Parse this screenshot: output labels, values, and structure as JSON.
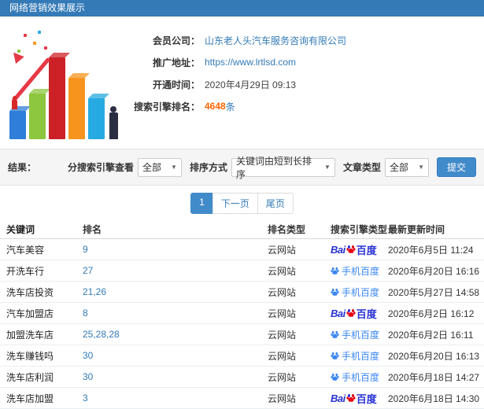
{
  "header": {
    "title": "网络营销效果展示"
  },
  "info": {
    "rows": [
      {
        "label": "会员公司：",
        "value": "山东老人头汽车服务咨询有限公司"
      },
      {
        "label": "推广地址：",
        "value": "https://www.lrtlsd.com"
      },
      {
        "label": "开通时间：",
        "value": "2020年4月29日 09:13"
      },
      {
        "label": "搜索引擎排名：",
        "value": "4648",
        "unit": "条"
      }
    ]
  },
  "filters": {
    "section_label": "结果：",
    "groups": [
      {
        "label": "分搜索引擎查看",
        "value": "全部"
      },
      {
        "label": "排序方式",
        "value": "关键词由短到长排序"
      },
      {
        "label": "文章类型",
        "value": "全部"
      }
    ],
    "submit_label": "提交"
  },
  "pagination": {
    "current": "1",
    "next_label": "下一页",
    "last_label": "尾页"
  },
  "table": {
    "headers": [
      "关键词",
      "排名",
      "排名类型",
      "搜索引擎类型",
      "最新更新时间"
    ],
    "engine": {
      "baidu_bai": "Bai",
      "baidu_text": "百度",
      "mobile_text": "手机百度"
    },
    "rows": [
      {
        "keyword": "汽车美容",
        "rank": "9",
        "rank_type": "云网站",
        "engine": "baidu",
        "time": "2020年6月5日 11:24"
      },
      {
        "keyword": "开洗车行",
        "rank": "27",
        "rank_type": "云网站",
        "engine": "mobile",
        "time": "2020年6月20日 16:16"
      },
      {
        "keyword": "洗车店投资",
        "rank": "21,26",
        "rank_type": "云网站",
        "engine": "mobile",
        "time": "2020年5月27日 14:58"
      },
      {
        "keyword": "汽车加盟店",
        "rank": "8",
        "rank_type": "云网站",
        "engine": "baidu",
        "time": "2020年6月2日 16:12"
      },
      {
        "keyword": "加盟洗车店",
        "rank": "25,28,28",
        "rank_type": "云网站",
        "engine": "mobile",
        "time": "2020年6月2日 16:11"
      },
      {
        "keyword": "洗车赚钱吗",
        "rank": "30",
        "rank_type": "云网站",
        "engine": "mobile",
        "time": "2020年6月20日 16:13"
      },
      {
        "keyword": "洗车店利润",
        "rank": "30",
        "rank_type": "云网站",
        "engine": "mobile",
        "time": "2020年6月18日 14:27"
      },
      {
        "keyword": "洗车店加盟",
        "rank": "3",
        "rank_type": "云网站",
        "engine": "baidu",
        "time": "2020年6月18日 14:30"
      }
    ]
  },
  "colors": {
    "accent": "#337ab7",
    "button": "#428bca",
    "highlight": "#ff6600"
  }
}
